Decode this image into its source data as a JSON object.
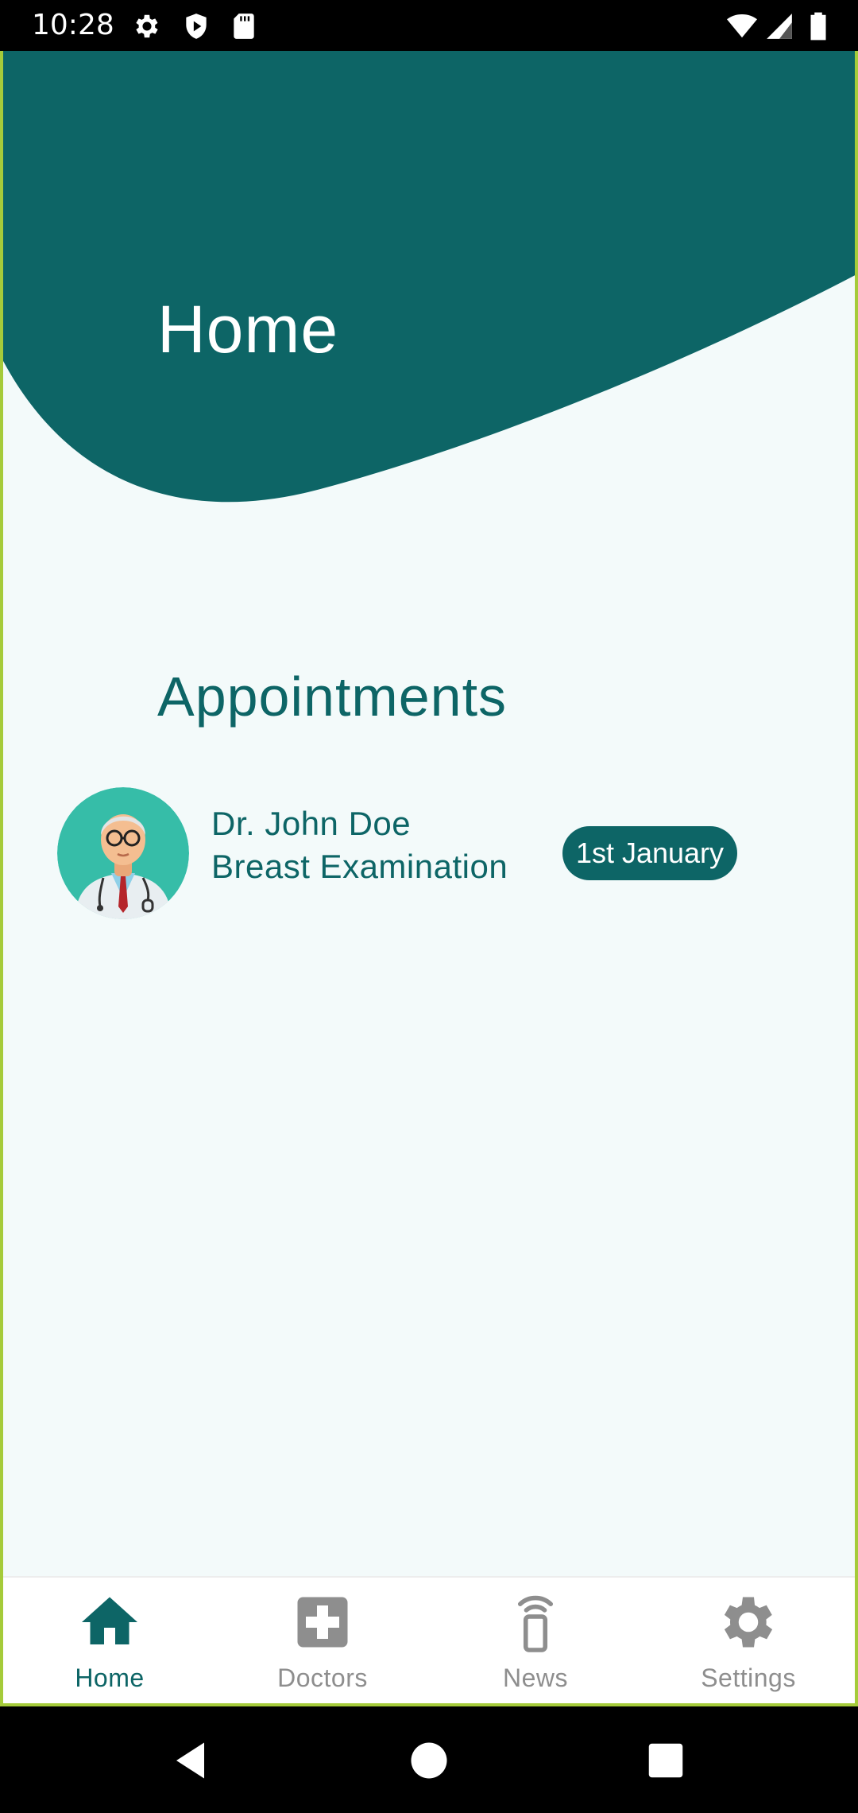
{
  "status_bar": {
    "time": "10:28",
    "left_icons": [
      "gear-icon",
      "shield-play-icon",
      "sd-card-icon"
    ],
    "right_icons": [
      "wifi-icon",
      "signal-icon",
      "battery-icon"
    ]
  },
  "header": {
    "title": "Home",
    "color": "#0D6566"
  },
  "appointments": {
    "title": "Appointments",
    "items": [
      {
        "doctor": "Dr. John Doe",
        "type": "Breast Examination",
        "date": "1st January",
        "avatar": "doctor-avatar-icon"
      }
    ]
  },
  "bottom_nav": {
    "items": [
      {
        "label": "Home",
        "icon": "home-icon",
        "active": true
      },
      {
        "label": "Doctors",
        "icon": "medical-cross-icon",
        "active": false
      },
      {
        "label": "News",
        "icon": "phone-broadcast-icon",
        "active": false
      },
      {
        "label": "Settings",
        "icon": "gear-icon",
        "active": false
      }
    ],
    "active_color": "#0D6566",
    "inactive_color": "#8E8E8E"
  },
  "system_nav": {
    "buttons": [
      "back-icon",
      "home-circle-icon",
      "recents-icon"
    ]
  }
}
